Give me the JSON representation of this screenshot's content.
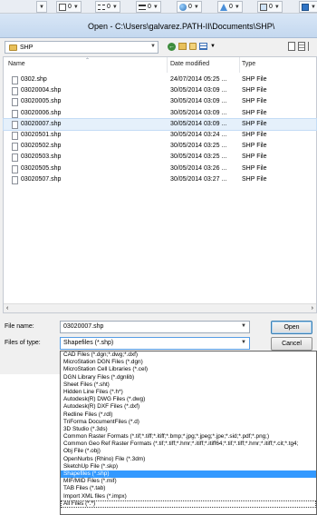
{
  "toolbar": {
    "items": [
      {
        "value": "0"
      },
      {
        "value": "0"
      },
      {
        "value": "0"
      },
      {
        "value": "0"
      },
      {
        "value": "0"
      },
      {
        "value": "0"
      }
    ]
  },
  "window": {
    "title": "Open - C:\\Users\\galvarez.PATH-II\\Documents\\SHP\\"
  },
  "address": {
    "folder": "SHP"
  },
  "columns": {
    "name": "Name",
    "date": "Date modified",
    "type": "Type"
  },
  "files": [
    {
      "name": "0302.shp",
      "date": "24/07/2014 05:25 ...",
      "type": "SHP File"
    },
    {
      "name": "03020004.shp",
      "date": "30/05/2014 03:09 ...",
      "type": "SHP File"
    },
    {
      "name": "03020005.shp",
      "date": "30/05/2014 03:09 ...",
      "type": "SHP File"
    },
    {
      "name": "03020006.shp",
      "date": "30/05/2014 03:09 ...",
      "type": "SHP File"
    },
    {
      "name": "03020007.shp",
      "date": "30/05/2014 03:09 ...",
      "type": "SHP File"
    },
    {
      "name": "03020501.shp",
      "date": "30/05/2014 03:24 ...",
      "type": "SHP File"
    },
    {
      "name": "03020502.shp",
      "date": "30/05/2014 03:25 ...",
      "type": "SHP File"
    },
    {
      "name": "03020503.shp",
      "date": "30/05/2014 03:25 ...",
      "type": "SHP File"
    },
    {
      "name": "03020505.shp",
      "date": "30/05/2014 03:26 ...",
      "type": "SHP File"
    },
    {
      "name": "03020507.shp",
      "date": "30/05/2014 03:27 ...",
      "type": "SHP File"
    }
  ],
  "selected_file_index": 4,
  "form": {
    "file_name_label": "File name:",
    "file_name_value": "03020007.shp",
    "file_type_label": "Files of type:",
    "file_type_value": "Shapefiles (*.shp)",
    "open_label": "Open",
    "cancel_label": "Cancel"
  },
  "file_types": [
    "CAD Files (*.dgn;*.dwg;*.dxf)",
    "MicroStation DGN Files (*.dgn)",
    "MicroStation Cell Libraries (*.cel)",
    "DGN Library Files (*.dgnlib)",
    "Sheet Files (*.sht)",
    "Hidden Line Files (*.h*)",
    "Autodesk(R) DWG Files (*.dwg)",
    "Autodesk(R) DXF Files (*.dxf)",
    "Redline Files (*.rdl)",
    "TriForma DocumentFiles (*.d)",
    "3D Studio (*.3ds)",
    "Common Raster Formats (*.tif;*.tiff;*.itiff;*.bmp;*.jpg;*.jpeg;*.jpe;*.sid;*.pdf;*.png;)",
    "Common Geo Ref Raster Formats (*.tif;*.tiff;*.hmr;*.itiff;*.itiff64;*.tif;*.tiff;*.hmr;*.itiff;*.cit;*.tg4;",
    "Obj File (*.obj)",
    "OpenNurbs (Rhino) File (*.3dm)",
    "SketchUp File (*.skp)",
    "Shapefiles (*.shp)",
    "MIF/MID Files (*.mif)",
    "TAB Files (*.tab)",
    "Import XML files (*.impx)",
    "All Files (*.*)"
  ],
  "selected_type_index": 16,
  "icons": {
    "folder": "folder-icon",
    "back": "back-arrow-icon",
    "up": "up-folder-icon",
    "new_folder": "new-folder-icon",
    "views": "views-icon"
  }
}
